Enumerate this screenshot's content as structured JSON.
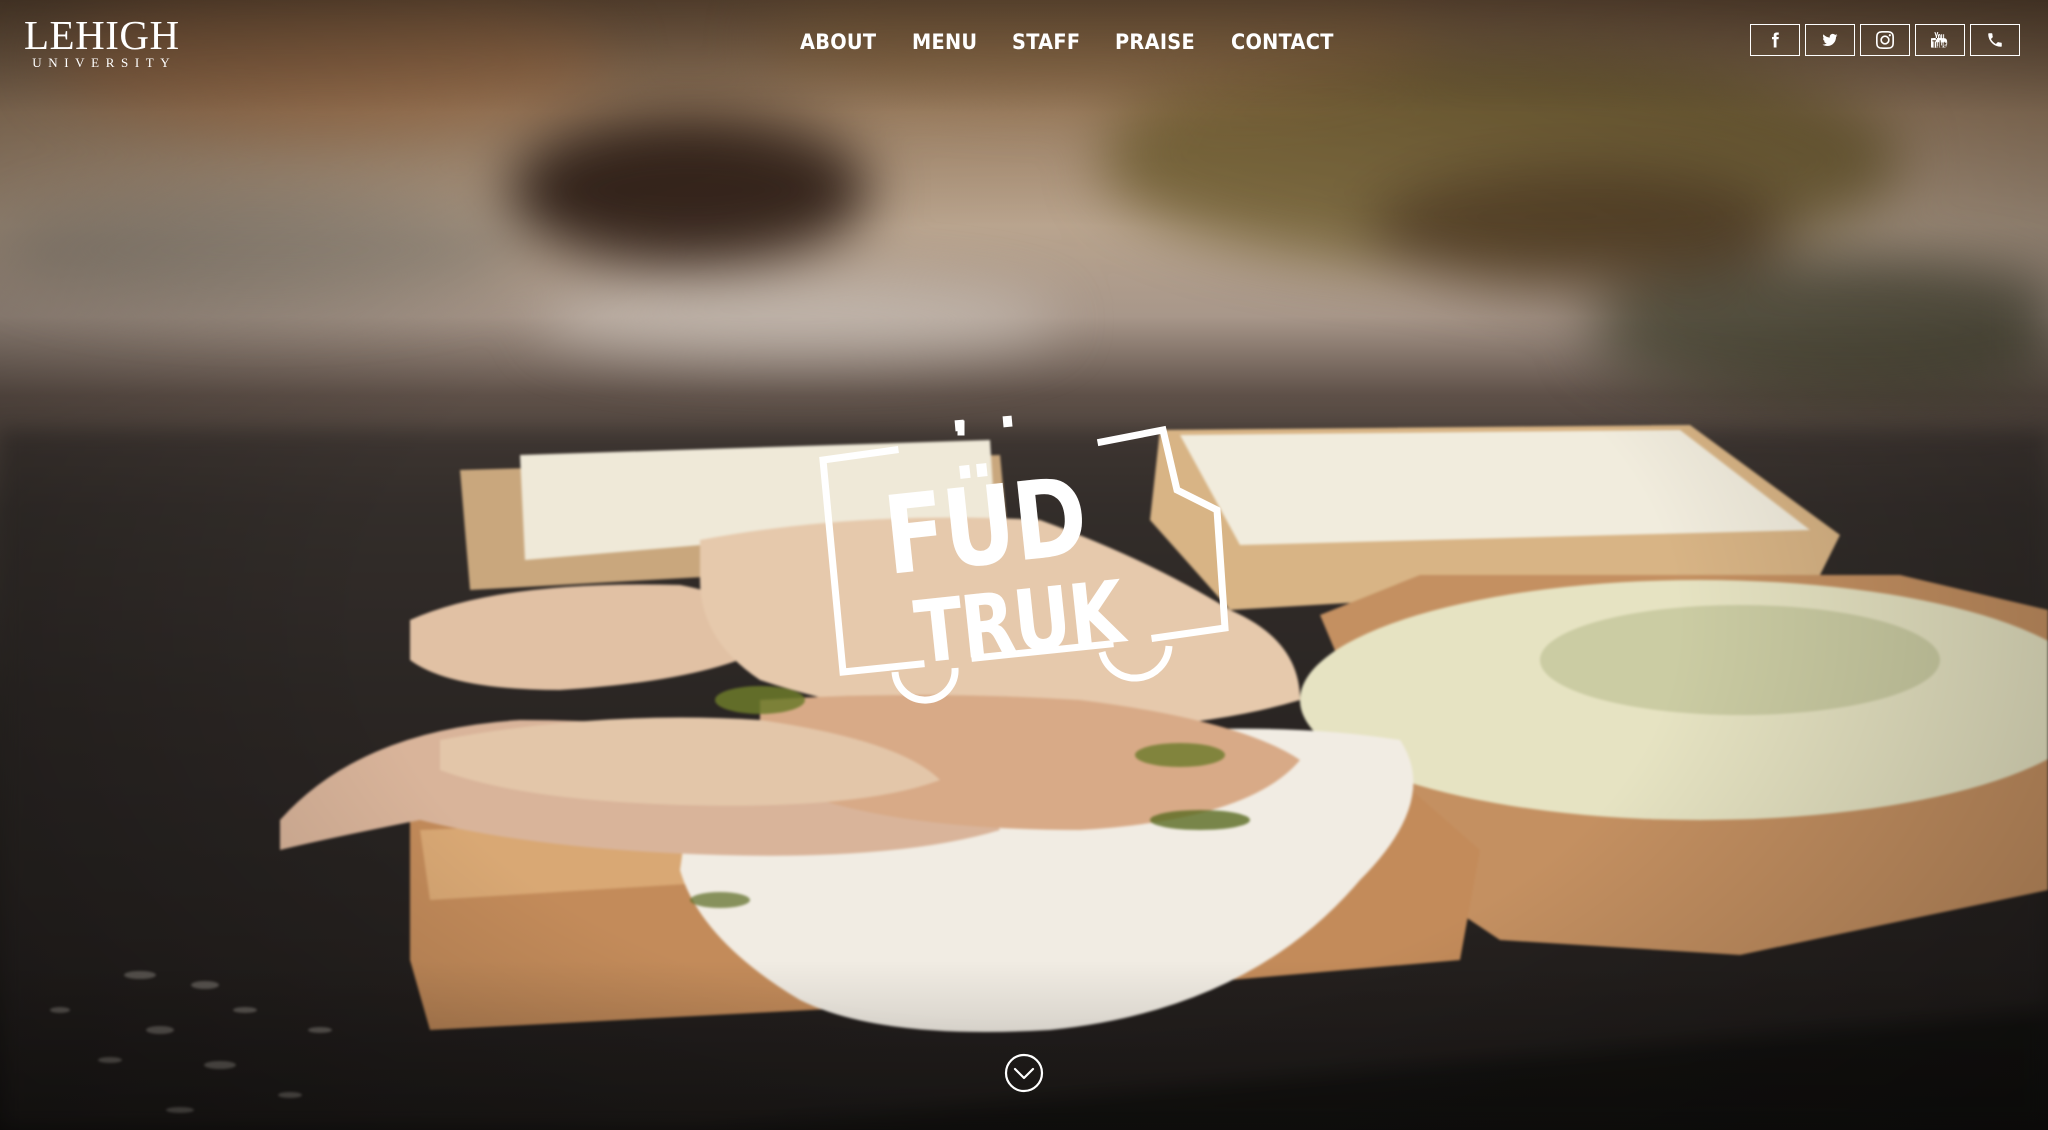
{
  "brand": {
    "logo_main": "LEHIGH",
    "logo_sub": "UNIVERSITY"
  },
  "nav": {
    "items": [
      {
        "label": "ABOUT"
      },
      {
        "label": "MENU"
      },
      {
        "label": "STAFF"
      },
      {
        "label": "PRAISE"
      },
      {
        "label": "CONTACT"
      }
    ]
  },
  "social": {
    "icons": [
      "facebook-icon",
      "twitter-icon",
      "instagram-icon",
      "youtube-icon",
      "phone-icon"
    ]
  },
  "hero": {
    "logo_line1": "FÜD",
    "logo_line2": "TRUK",
    "scroll_icon": "chevron-down-circle-icon"
  },
  "colors": {
    "text": "#ffffff",
    "accent": "#ffffff"
  }
}
